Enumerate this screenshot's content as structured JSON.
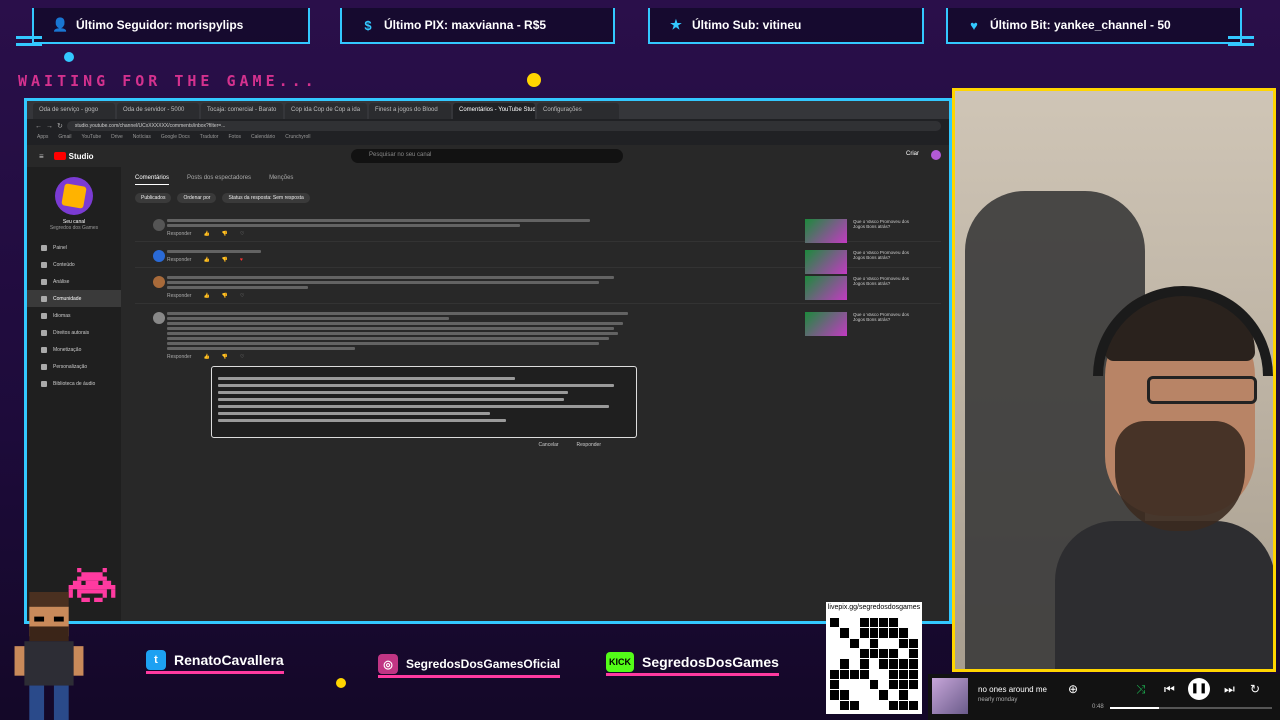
{
  "overlay": {
    "follower_label": "Último Seguidor: morispylips",
    "pix_label": "Último PIX: maxvianna - R$5",
    "sub_label": "Último Sub: vitineu",
    "bit_label": "Último Bit: yankee_channel - 50",
    "waiting_text": "WAITING FOR THE GAME...",
    "colors": {
      "accent_cyan": "#33c8ff",
      "accent_yellow": "#ffd500",
      "accent_pink": "#ff3aa0"
    }
  },
  "browser": {
    "tabs": [
      "Oda de serviço - gogo",
      "Oda de servidor - 5000",
      "Tocaja: comercial - Barato",
      "Cop ida Cop de Cop a ida",
      "Finest a jogos do Blood",
      "Comentários - YouTube Studio",
      "Configurações"
    ],
    "active_tab_index": 5,
    "address": "studio.youtube.com/channel/UCxXXXXXX/comments/inbox?filter=...",
    "bookmarks": [
      "Apps",
      "Gmail",
      "YouTube",
      "Drive",
      "Notícias",
      "Google Docs",
      "Tradutor",
      "Fotos",
      "Calendário",
      "Crunchyroll"
    ]
  },
  "studio": {
    "logo_label": "Studio",
    "search_placeholder": "Pesquisar no seu canal",
    "create_label": "Criar",
    "channel_name": "Seu canal",
    "channel_sub": "Segredos dos Games",
    "nav": [
      "Painel",
      "Conteúdo",
      "Análise",
      "Comunidade",
      "Idiomas",
      "Direitos autorais",
      "Monetização",
      "Personalização",
      "Biblioteca de áudio"
    ],
    "active_nav_index": 3,
    "subtabs": [
      "Comentários",
      "Posts dos espectadores",
      "Menções"
    ],
    "filters": [
      "Publicados",
      "Ordenar por",
      "Status da resposta: Sem resposta"
    ],
    "reply_label": "Responder",
    "reply_submit": "Responder",
    "cancel_label": "Cancelar",
    "video_title": "Que o Vasco Promoveu dos Jogos Bons atrás?"
  },
  "social": {
    "twitter": "RenatoCavallera",
    "instagram": "SegredosDosGamesOficial",
    "kick": "SegredosDosGames",
    "qr_url": "livepix.gg/segredosdosgames"
  },
  "player": {
    "song_title": "no ones around me",
    "song_artist": "nearly monday",
    "elapsed": "0:48",
    "progress": 0.3
  }
}
